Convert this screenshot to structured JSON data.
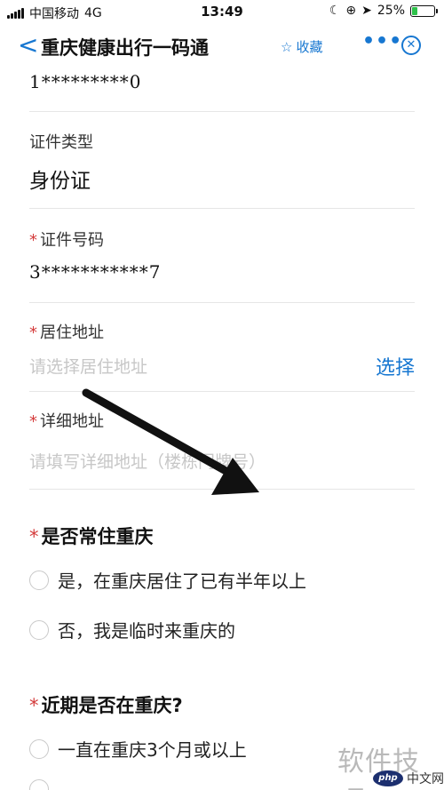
{
  "status_bar": {
    "carrier": "中国移动",
    "network": "4G",
    "time": "13:49",
    "battery_percent": "25%",
    "battery_level": 0.25
  },
  "nav": {
    "back_glyph": "<",
    "title": "重庆健康出行一码通",
    "favorite_label": "收藏",
    "more_glyph": "•••"
  },
  "form": {
    "top_value": "1*********0",
    "id_type_label": "证件类型",
    "id_type_value": "身份证",
    "id_number_label": "证件号码",
    "id_number_value": "3***********7",
    "address_label": "居住地址",
    "address_placeholder": "请选择居住地址",
    "address_select": "选择",
    "detail_label": "详细地址",
    "detail_placeholder": "请填写详细地址（楼栋门牌号）",
    "required_mark": "*"
  },
  "questions": [
    {
      "title": "是否常住重庆",
      "options": [
        "是，在重庆居住了已有半年以上",
        "否，我是临时来重庆的"
      ]
    },
    {
      "title": "近期是否在重庆?",
      "options": [
        "一直在重庆3个月或以上",
        "..."
      ]
    }
  ],
  "watermark": {
    "text": "软件技巧",
    "php_logo": "php",
    "php_text": "中文网"
  },
  "colors": {
    "accent": "#1777d1",
    "required": "#d43b3b",
    "placeholder": "#c7c7c7"
  }
}
